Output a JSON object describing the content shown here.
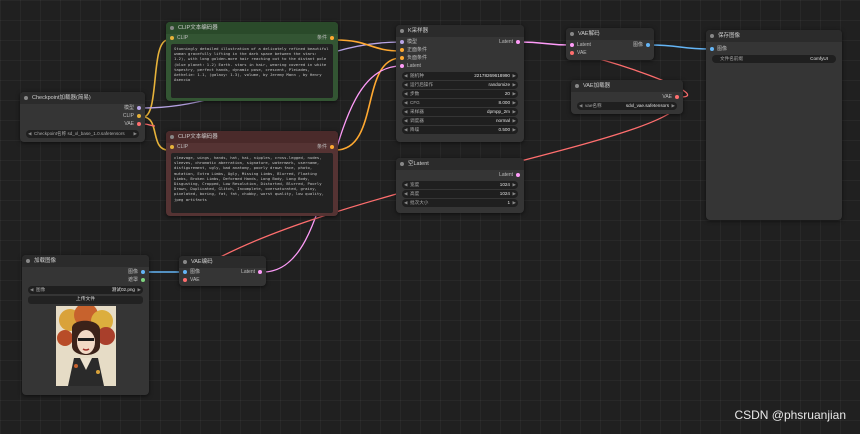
{
  "colors": {
    "canvas": "#202020",
    "node": "#353535",
    "positive_node": "#335533",
    "negative_node": "#553333",
    "wire_clip": "#e6b23a",
    "wire_model": "#b9a6e8",
    "wire_latent": "#ff9cf9",
    "wire_vae": "#ff6e6e",
    "wire_image": "#64b5f6",
    "wire_conditioning": "#ffa931"
  },
  "nodes": {
    "checkpoint": {
      "title": "Checkpoint加载器(简易)",
      "outputs": [
        "模型",
        "CLIP",
        "VAE"
      ],
      "ckpt_name": "Checkpoint名称 sd_xl_base_1.0.safetensors"
    },
    "clip_pos": {
      "title": "CLIP文本编码器",
      "input": "CLIP",
      "output": "条件",
      "text": "Stunningly detailed illustration of a delicately refined beautiful woman gracefully lifting in the dark space between the stars: 1.2), with long golden-more hair reaching out to the distant pole (blue planet: 1.2) Earth. stars in hair, wearing covered in white tapestry, perfect hands, dynamic pose, crescent, Pleiades, Aethelie: 1.1, (galaxy: 1.3), volume, by Jeremy Mann , by Henry Asencio"
    },
    "clip_neg": {
      "title": "CLIP文本编码器",
      "input": "CLIP",
      "output": "条件",
      "text": "cleavage, wings, hands, hat, hai, nipples, cross-legged, nudes, sleeves, chromatic aberration, signature, watermark, username, disfigurement, ugly, bad anatomy, poorly drawn face, photo, mutation, Extra Limbs, Ugly, Missing Limbs, Blurred, Floating Limbs, Broken Limbs, Deformed Hands, Long Body, Long Body, Disgusting, Cropped, Low Resolution, Distorted, Blurred, Poorly Drawn, Duplicated, Glitch, Incomplete, oversaturated, grainy, pixelated, boring, fat, fat, chubby, worst quality, low quality, jpeg artifacts"
    },
    "ksampler": {
      "title": "K采样器",
      "inputs": [
        "模型",
        "正面条件",
        "负面条件",
        "Latent"
      ],
      "output": "Latent",
      "widgets": [
        {
          "label": "随机种",
          "value": "22178269618990"
        },
        {
          "label": "运行后操作",
          "value": "randomize"
        },
        {
          "label": "步数",
          "value": "20"
        },
        {
          "label": "CFG",
          "value": "8.000"
        },
        {
          "label": "采样器",
          "value": "dpmpp_2m"
        },
        {
          "label": "调度器",
          "value": "normal"
        },
        {
          "label": "降噪",
          "value": "0.500"
        }
      ]
    },
    "latent": {
      "title": "空Latent",
      "output": "Latent",
      "widgets": [
        {
          "label": "宽度",
          "value": "1024"
        },
        {
          "label": "高度",
          "value": "1024"
        },
        {
          "label": "批次大小",
          "value": "1"
        }
      ]
    },
    "vae_decode": {
      "title": "VAE解码",
      "inputs": [
        "Latent",
        "VAE"
      ],
      "output": "图像"
    },
    "vae_loader": {
      "title": "VAE加载器",
      "output": "VAE",
      "vae_name": "vae名称",
      "vae_value": "sdxl_vae.safetensors"
    },
    "save_image": {
      "title": "保存图像",
      "input": "图像",
      "prefix_label": "文件名前缀",
      "prefix_value": "ComfyUI"
    },
    "load_image": {
      "title": "加载图像",
      "outputs": [
        "图像",
        "遮罩"
      ],
      "image_label": "图像",
      "image_value": "测试02.png",
      "upload_label": "上传文件"
    },
    "vae_encode": {
      "title": "VAE编码",
      "inputs": [
        "图像",
        "VAE"
      ],
      "output": "Latent"
    }
  },
  "watermark": "CSDN @phsruanjian"
}
